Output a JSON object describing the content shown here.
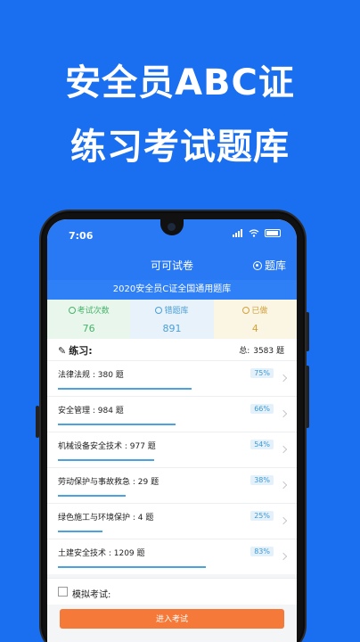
{
  "promo": {
    "line1": "安全员ABC证",
    "line2": "练习考试题库"
  },
  "status": {
    "time": "7:06"
  },
  "nav": {
    "title": "可可试卷",
    "bank_label": "题库"
  },
  "subtitle": "2020安全员C证全国通用题库",
  "stats": [
    {
      "label": "考试次数",
      "value": "76"
    },
    {
      "label": "错题库",
      "value": "891"
    },
    {
      "label": "已做",
      "value": "4"
    }
  ],
  "practice": {
    "title": "练习:",
    "total_label": "总:",
    "total_value": "3583 题"
  },
  "rows": [
    {
      "label": "法律法规 : 380 题",
      "percent": "75%",
      "progress": 0.75
    },
    {
      "label": "安全管理 : 984 题",
      "percent": "66%",
      "progress": 0.66
    },
    {
      "label": "机械设备安全技术 : 977 题",
      "percent": "54%",
      "progress": 0.54
    },
    {
      "label": "劳动保护与事故救急 : 29 题",
      "percent": "38%",
      "progress": 0.38
    },
    {
      "label": "绿色施工与环境保护 : 4 题",
      "percent": "25%",
      "progress": 0.25
    },
    {
      "label": "土建安全技术 : 1209 题",
      "percent": "83%",
      "progress": 0.83
    }
  ],
  "mock": {
    "label": "模拟考试:",
    "button": "进入考试"
  },
  "colors": {
    "background": "#1a6ff0",
    "header": "#2979f5",
    "accent_button": "#f57a3a",
    "progress": "#4aa3df"
  }
}
